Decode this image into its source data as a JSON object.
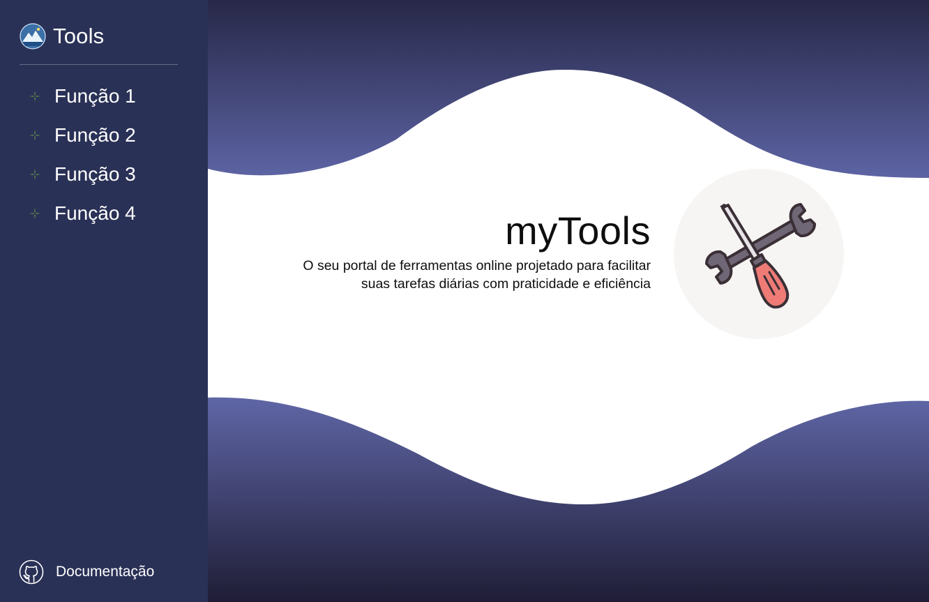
{
  "sidebar": {
    "brand": {
      "title": "Tools",
      "logo_icon": "mountain-logo-icon"
    },
    "items": [
      {
        "label": "Função 1",
        "icon": "sparkle-icon"
      },
      {
        "label": "Função 2",
        "icon": "sparkle-icon"
      },
      {
        "label": "Função 3",
        "icon": "sparkle-icon"
      },
      {
        "label": "Função 4",
        "icon": "sparkle-icon"
      }
    ],
    "footer": {
      "label": "Documentação",
      "icon": "github-icon"
    }
  },
  "main": {
    "hero": {
      "title": "myTools",
      "subtitle_line1": "O seu portal de ferramentas online projetado para facilitar",
      "subtitle_line2": "suas tarefas diárias com praticidade e eficiência"
    },
    "illustration_icon": "wrench-screwdriver-icon"
  },
  "colors": {
    "sidebar_bg": "#2a3156",
    "wave_dark": "#272848",
    "wave_light": "#5d64a4",
    "accent_sparkle": "#5f8a4c"
  }
}
